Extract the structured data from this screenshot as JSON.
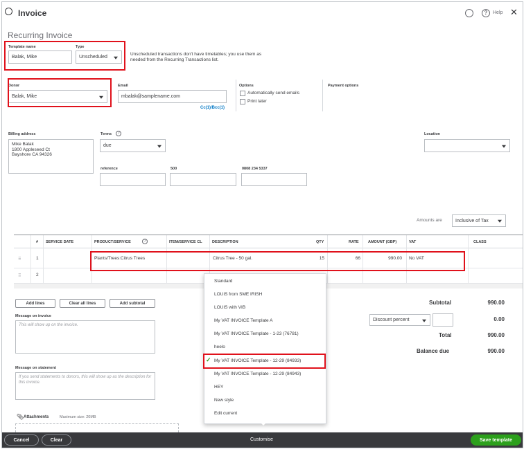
{
  "header": {
    "title": "Invoice",
    "help_label": "Help",
    "subtitle": "Recurring Invoice"
  },
  "template": {
    "name_label": "Template name",
    "name_value": "Balak, Mike",
    "type_label": "Type",
    "type_value": "Unscheduled",
    "info_text": "Unscheduled transactions don't have timetables; you use them as needed from the Recurring Transactions list."
  },
  "donor": {
    "label": "Donor",
    "value": "Balak, Mike",
    "email_label": "Email",
    "email_value": "mbalak@samplename.com",
    "cc_bcc": "Cc(1)/Bcc(1)"
  },
  "options": {
    "label": "Options",
    "auto_send": "Automatically send emails",
    "print_later": "Print later",
    "payment_options": "Payment options"
  },
  "billing": {
    "label": "Billing address",
    "lines": [
      "Mike Balak",
      "1800 Appleseed Ct",
      "Bayshore CA 94326"
    ],
    "terms_label": "Terms",
    "terms_value": "due",
    "location_label": "Location",
    "reference_label": "reference",
    "field_500_label": "500",
    "phone_label": "0808 234 5337"
  },
  "amounts": {
    "label": "Amounts are",
    "value": "Inclusive of Tax"
  },
  "table": {
    "headers": [
      "#",
      "SERVICE DATE",
      "PRODUCT/SERVICE",
      "ITEM/SERVICE CL",
      "DESCRIPTION",
      "QTY",
      "RATE",
      "AMOUNT (GBP)",
      "VAT",
      "CLASS"
    ],
    "rows": [
      {
        "num": "1",
        "product": "Plants/Trees:Citrus Trees",
        "description": "Citrus Tree - 50 gal.",
        "qty": "15",
        "rate": "66",
        "amount": "990.00",
        "vat": "No VAT"
      },
      {
        "num": "2",
        "product": "",
        "description": "",
        "qty": "",
        "rate": "",
        "amount": "",
        "vat": ""
      }
    ]
  },
  "actions": {
    "add_lines": "Add lines",
    "clear_all_lines": "Clear all lines",
    "add_subtotal": "Add subtotal"
  },
  "message_invoice": {
    "label": "Message on invoice",
    "placeholder": "This will show up on the invoice."
  },
  "message_statement": {
    "label": "Message on statement",
    "placeholder": "If you send statements to donors, this will show up as the description for this invoice."
  },
  "attachments": {
    "label": "Attachments",
    "max_size": "Maximum size: 20MB"
  },
  "totals": {
    "subtotal_label": "Subtotal",
    "subtotal_value": "990.00",
    "discount_label": "Discount percent",
    "discount_value": "0.00",
    "total_label": "Total",
    "total_value": "990.00",
    "balance_label": "Balance due",
    "balance_value": "990.00"
  },
  "dropdown": {
    "items": [
      "Standard",
      "LOUIS from SME IRISH",
      "LOUIS with VIB",
      "My VAT INVOICE Template A",
      "My VAT INVOICE Template - 1-23 (76781)",
      "heelo",
      "My VAT INVOICE Template - 12-29 (84933)",
      "My VAT INVOICE Template - 12-29 (84943)",
      "HEY",
      "New style",
      "Edit current"
    ],
    "selected": "My VAT INVOICE Template - 12-29 (84933)"
  },
  "footer": {
    "cancel": "Cancel",
    "clear": "Clear",
    "customise": "Customise",
    "save_template": "Save template"
  },
  "colors": {
    "accent_green": "#2ca01c",
    "highlight_red": "#e0111b",
    "footer_bg": "#393a3d"
  }
}
